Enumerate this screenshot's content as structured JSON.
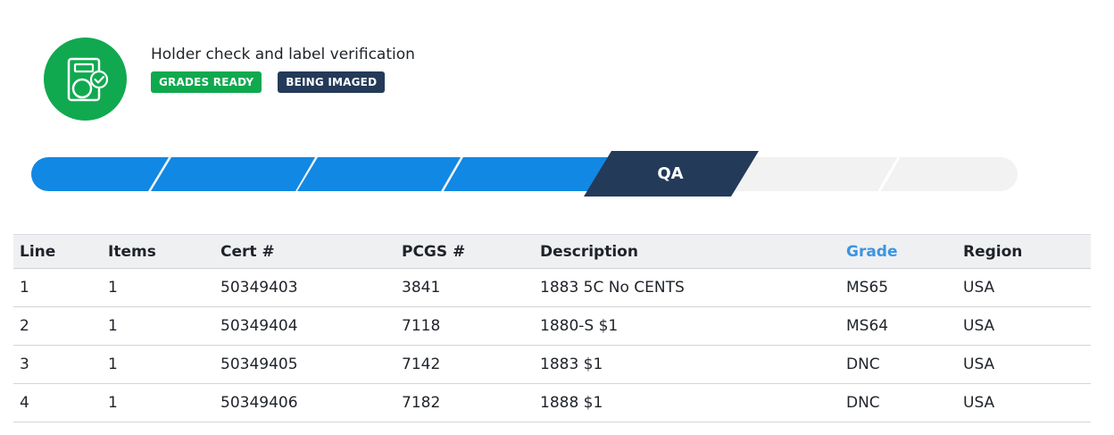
{
  "header": {
    "title": "Holder check and label verification",
    "icon": "holder-check-icon",
    "badges": [
      {
        "label": "GRADES READY",
        "color": "#10a94f"
      },
      {
        "label": "BEING IMAGED",
        "color": "#243a59"
      }
    ]
  },
  "tracker": {
    "current_step_label": "QA",
    "total_steps": 7,
    "current_step": 5,
    "colors": {
      "done": "#1188e3",
      "current": "#243a59",
      "pending": "#f2f2f3"
    }
  },
  "table": {
    "columns": [
      "Line",
      "Items",
      "Cert #",
      "PCGS #",
      "Description",
      "Grade",
      "Region"
    ],
    "rows": [
      [
        "1",
        "1",
        "50349403",
        "3841",
        "1883 5C No CENTS",
        "MS65",
        "USA"
      ],
      [
        "2",
        "1",
        "50349404",
        "7118",
        "1880-S $1",
        "MS64",
        "USA"
      ],
      [
        "3",
        "1",
        "50349405",
        "7142",
        "1883 $1",
        "DNC",
        "USA"
      ],
      [
        "4",
        "1",
        "50349406",
        "7182",
        "1888 $1",
        "DNC",
        "USA"
      ]
    ],
    "sort_column_color": "#3b95e0"
  }
}
